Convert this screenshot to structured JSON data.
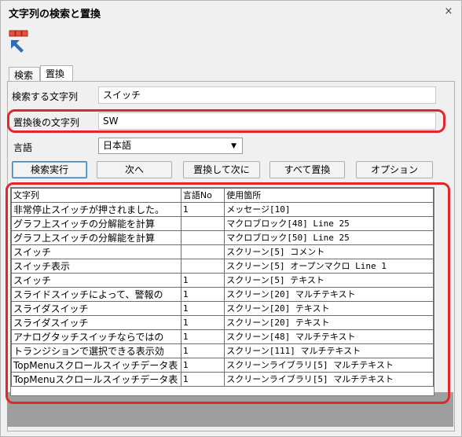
{
  "window": {
    "title": "文字列の検索と置換",
    "close_glyph": "×"
  },
  "tabs": [
    {
      "label": "検索",
      "active": false
    },
    {
      "label": "置換",
      "active": true
    }
  ],
  "search": {
    "label": "検索する文字列",
    "value": "スイッチ"
  },
  "replace": {
    "label": "置換後の文字列",
    "value": "SW"
  },
  "language": {
    "label": "言語",
    "selected": "日本語"
  },
  "buttons": {
    "execute": "検索実行",
    "next": "次へ",
    "replace_next": "置換して次に",
    "replace_all": "すべて置換",
    "options": "オプション"
  },
  "results": {
    "columns": [
      "文字列",
      "言語No",
      "使用箇所"
    ],
    "rows": [
      [
        "非常停止スイッチが押されました。",
        "1",
        "メッセージ[10]"
      ],
      [
        "グラフ上スイッチの分解能を計算",
        "",
        "マクロブロック[48] Line 25"
      ],
      [
        "グラフ上スイッチの分解能を計算",
        "",
        "マクロブロック[50] Line 25"
      ],
      [
        "スイッチ",
        "",
        "スクリーン[5] コメント"
      ],
      [
        "スイッチ表示",
        "",
        "スクリーン[5] オープンマクロ Line 1"
      ],
      [
        "スイッチ",
        "1",
        "スクリーン[5] テキスト"
      ],
      [
        "スライドスイッチによって、警報の",
        "1",
        "スクリーン[20] マルチテキスト"
      ],
      [
        "スライダスイッチ",
        "1",
        "スクリーン[20] テキスト"
      ],
      [
        "スライダスイッチ",
        "1",
        "スクリーン[20] テキスト"
      ],
      [
        "アナログタッチスイッチならではの",
        "1",
        "スクリーン[48] マルチテキスト"
      ],
      [
        "トランジションで選択できる表示効",
        "1",
        "スクリーン[111] マルチテキスト"
      ],
      [
        "TopMenuスクロールスイッチデータ表",
        "1",
        "スクリーンライブラリ[5] マルチテキスト"
      ],
      [
        "TopMenuスクロールスイッチデータ表",
        "1",
        "スクリーンライブラリ[5] マルチテキスト"
      ]
    ]
  },
  "colors": {
    "highlight": "#e3262b",
    "accent": "#3c7fb1"
  }
}
